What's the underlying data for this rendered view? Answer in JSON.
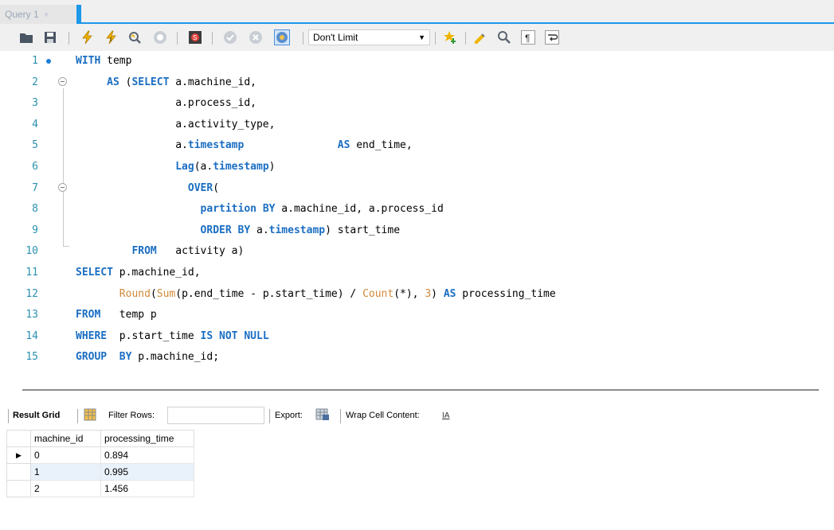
{
  "tab": {
    "title": "Query 1",
    "close": "×"
  },
  "toolbar": {
    "limit": "Don't Limit",
    "icons": [
      "open-folder-icon",
      "save-icon",
      "execute-icon",
      "execute-current-icon",
      "explain-icon",
      "stop-icon",
      "toggle-autocommit-icon",
      "commit-icon",
      "rollback-icon",
      "toggle-error-icon",
      "add-snippet-icon",
      "beautify-icon",
      "find-icon",
      "invisible-chars-icon",
      "wrap-icon"
    ]
  },
  "editor": {
    "lines": [
      {
        "n": "1",
        "html": "<span class=\"kw\">WITH</span> temp"
      },
      {
        "n": "2",
        "html": "     <span class=\"kw\">AS</span> (<span class=\"kw\">SELECT</span> a.machine_id,"
      },
      {
        "n": "3",
        "html": "                a.process_id,"
      },
      {
        "n": "4",
        "html": "                a.activity_type,"
      },
      {
        "n": "5",
        "html": "                a.<span class=\"kw\">timestamp</span>               <span class=\"kw\">AS</span> end_time,"
      },
      {
        "n": "6",
        "html": "                <span class=\"fn\">Lag</span>(a.<span class=\"kw\">timestamp</span>)"
      },
      {
        "n": "7",
        "html": "                  <span class=\"kw\">OVER</span>("
      },
      {
        "n": "8",
        "html": "                    <span class=\"kw\">partition BY</span> a.machine_id, a.process_id"
      },
      {
        "n": "9",
        "html": "                    <span class=\"kw\">ORDER BY</span> a.<span class=\"kw\">timestamp</span>) start_time"
      },
      {
        "n": "10",
        "html": "         <span class=\"kw\">FROM</span>   activity a)"
      },
      {
        "n": "11",
        "html": "<span class=\"kw\">SELECT</span> p.machine_id,"
      },
      {
        "n": "12",
        "html": "       <span class=\"fnl\">Round</span>(<span class=\"fnl\">Sum</span>(p.end_time - p.start_time) / <span class=\"fnl\">Count</span>(*), <span class=\"num\">3</span>) <span class=\"kw\">AS</span> processing_time"
      },
      {
        "n": "13",
        "html": "<span class=\"kw\">FROM</span>   temp p"
      },
      {
        "n": "14",
        "html": "<span class=\"kw\">WHERE</span>  p.start_time <span class=\"kw\">IS NOT NULL</span>"
      },
      {
        "n": "15",
        "html": "<span class=\"kw\">GROUP</span>  <span class=\"kw\">BY</span> p.machine_id;"
      }
    ]
  },
  "results": {
    "result_grid": "Result Grid",
    "filter_rows": "Filter Rows:",
    "export": "Export:",
    "wrap": "Wrap Cell Content:",
    "columns": [
      "machine_id",
      "processing_time"
    ],
    "rows": [
      [
        "0",
        "0.894"
      ],
      [
        "1",
        "0.995"
      ],
      [
        "2",
        "1.456"
      ]
    ],
    "selected_marker": "▶"
  }
}
